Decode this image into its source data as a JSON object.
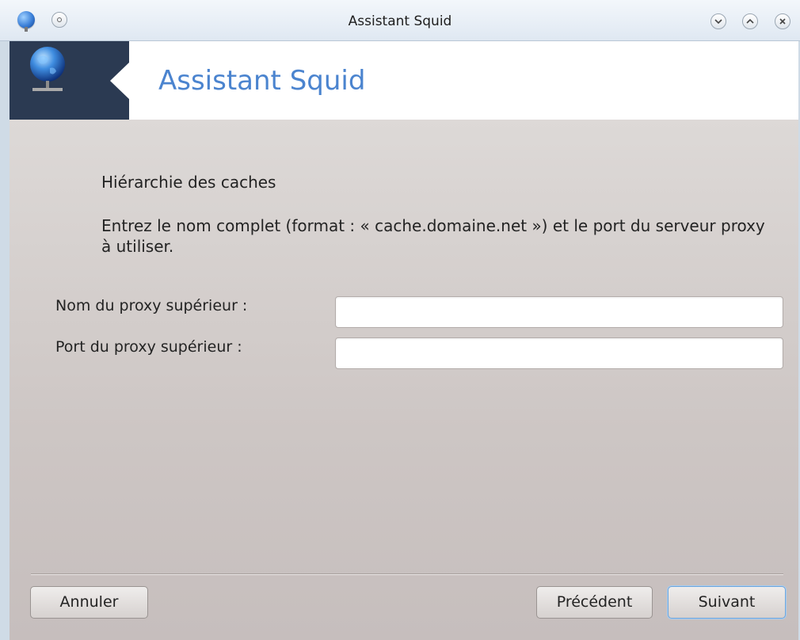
{
  "window": {
    "title": "Assistant Squid",
    "icons": {
      "app": "globe-network-icon",
      "pin": "pin-icon",
      "minimize": "chevron-down-icon",
      "maximize": "chevron-up-icon",
      "close": "close-icon"
    }
  },
  "header": {
    "title": "Assistant Squid",
    "icon": "globe-network-icon",
    "accent_color": "#4b84cf",
    "dark_color": "#2b3a52"
  },
  "content": {
    "section_title": "Hiérarchie des caches",
    "description": "Entrez le nom complet (format : « cache.domaine.net ») et le port du serveur proxy à utiliser.",
    "fields": [
      {
        "label": "Nom du proxy supérieur :",
        "value": ""
      },
      {
        "label": "Port du proxy supérieur :",
        "value": ""
      }
    ]
  },
  "buttons": {
    "cancel": "Annuler",
    "previous": "Précédent",
    "next": "Suivant"
  }
}
